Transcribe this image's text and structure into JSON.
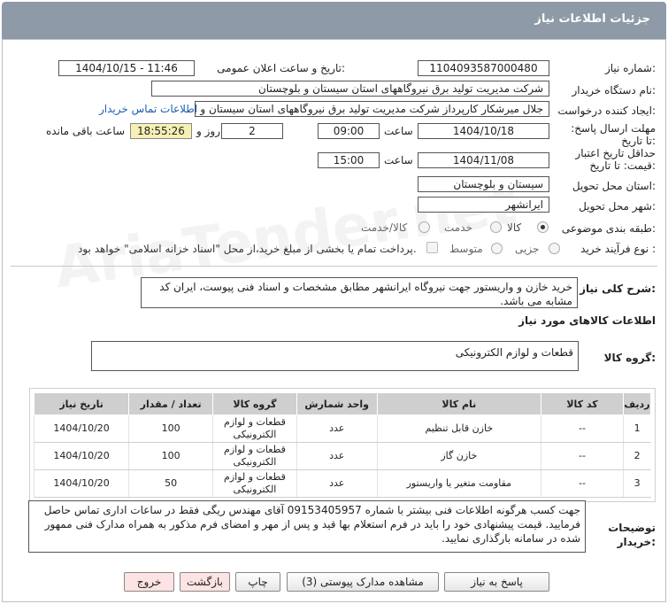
{
  "header": {
    "title": "جزئیات اطلاعات نیاز"
  },
  "watermark": {
    "text": "AriaTender.net"
  },
  "form": {
    "need_number_label": "شماره نیاز:",
    "need_number": "1104093587000480",
    "announce_label": "تاریخ و ساعت اعلان عمومی:",
    "announce_value": "1404/10/15 - 11:46",
    "buyer_label": "نام دستگاه خریدار:",
    "buyer_value": "شرکت مدیریت تولید برق نیروگاههای استان سیستان و بلوچستان",
    "creator_label": "ایجاد کننده درخواست:",
    "creator_value": "جلال میرشکار کارپرداز شرکت مدیریت تولید برق نیروگاههای استان سیستان و با",
    "contact_link": "اطلاعات تماس خریدار",
    "deadline_label": "مهلت ارسال پاسخ: تا تاریخ:",
    "deadline_date": "1404/10/18",
    "time_label": "ساعت",
    "deadline_time": "09:00",
    "days_value": "2",
    "days_label": "روز و",
    "remaining_time": "18:55:26",
    "remaining_label": "ساعت باقی مانده",
    "validity_label": "حداقل تاریخ اعتبار قیمت: تا تاریخ:",
    "validity_date": "1404/11/08",
    "validity_time_label": "ساعت",
    "validity_time": "15:00",
    "province_label": "استان محل تحویل:",
    "province_value": "سیستان و بلوچستان",
    "city_label": "شهر محل تحویل:",
    "city_value": "ایرانشهر",
    "category_label": "طبقه بندی موضوعی:",
    "category_options": [
      "کالا",
      "خدمت",
      "کالا/خدمت"
    ],
    "category_selected": "کالا",
    "process_label": "نوع فرآیند خرید :",
    "process_options": [
      "جزیی",
      "متوسط"
    ],
    "payment_note": "پرداخت تمام یا بخشی از مبلغ خرید،از محل \"اسناد خزانه اسلامی\" خواهد بود."
  },
  "description": {
    "label": "شرح کلی نیاز:",
    "text": "خرید خازن و واریستور جهت نیروگاه ایرانشهر مطابق مشخصات و اسناد فنی پیوست، ایران کد مشابه می باشد."
  },
  "goods_info": {
    "title": "اطلاعات کالاهای مورد نیاز",
    "group_label": "گروه کالا:",
    "group_value": "قطعات و لوازم الکترونیکی"
  },
  "table": {
    "headers": [
      "ردیف",
      "کد کالا",
      "نام کالا",
      "واحد شمارش",
      "گروه کالا",
      "تعداد / مقدار",
      "تاریخ نیاز"
    ],
    "rows": [
      [
        "1",
        "--",
        "خازن قابل تنظیم",
        "عدد",
        "قطعات و لوازم الکترونیکی",
        "100",
        "1404/10/20"
      ],
      [
        "2",
        "--",
        "خازن گاز",
        "عدد",
        "قطعات و لوازم الکترونیکی",
        "100",
        "1404/10/20"
      ],
      [
        "3",
        "--",
        "مقاومت متغیر یا واریستور",
        "عدد",
        "قطعات و لوازم الکترونیکی",
        "50",
        "1404/10/20"
      ]
    ]
  },
  "buyer_notes": {
    "label": "توضیحات خریدار:",
    "text": "جهت کسب هرگونه اطلاعات فنی بیشتر با شماره 09153405957 آقای مهندس ریگی فقط در ساعات اداری تماس حاصل فرمایید. قیمت پیشنهادی خود را باید در فرم استعلام بها قید و پس از مهر و امضای فرم مذکور به همراه مدارک فنی ممهور شده در سامانه بارگذاری نمایید."
  },
  "buttons": {
    "reply": "پاسخ به نیاز",
    "attachments": "مشاهده مدارک پیوستی (3)",
    "print": "چاپ",
    "back": "بازگشت",
    "exit": "خروج"
  }
}
